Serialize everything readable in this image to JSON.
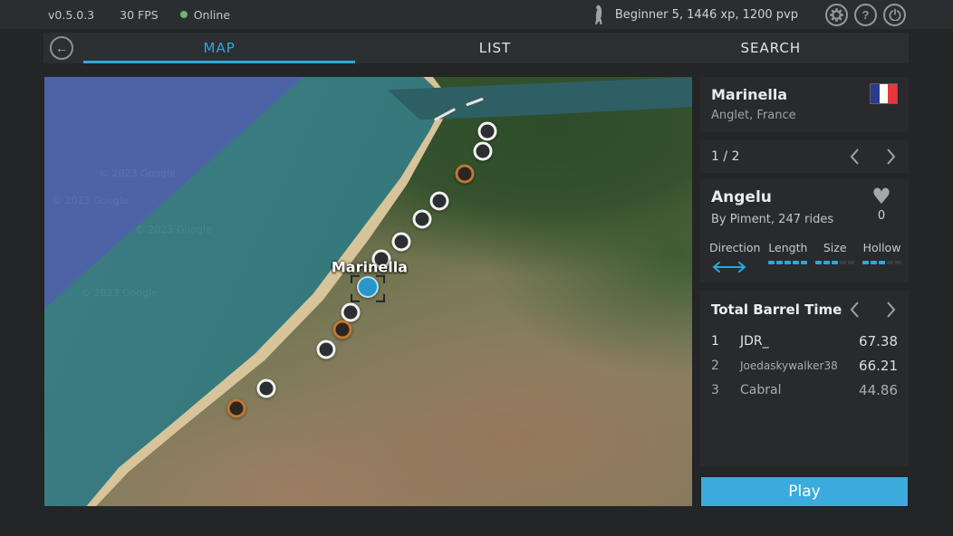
{
  "colors": {
    "accent": "#2ea7dd",
    "play_button": "#3aabdc",
    "marker_orange": "#bf7734",
    "marker_selected": "#2696cc",
    "online_green": "#6cb56f",
    "flag_blue": "#2a3b8f",
    "flag_red": "#e8363d"
  },
  "top_bar": {
    "version": "v0.5.0.3",
    "fps": "30 FPS",
    "online": "Online",
    "player_badge": "Beginner 5, 1446 xp, 1200 pvp",
    "icons": [
      "surfer-icon",
      "gear-icon",
      "question-icon",
      "power-icon"
    ]
  },
  "tabs": {
    "map": "MAP",
    "list": "LIST",
    "search": "SEARCH",
    "active": "MAP"
  },
  "location": {
    "name": "Marinella",
    "region": "Anglet, France",
    "flag": "france-flag"
  },
  "pagination": {
    "label": "1 / 2"
  },
  "spot": {
    "name": "Angelu",
    "byline": "By Piment, 247 rides",
    "likes": "0",
    "attrs": [
      {
        "label": "Direction",
        "type": "arrows"
      },
      {
        "label": "Length",
        "value": 5,
        "max": 5
      },
      {
        "label": "Size",
        "value": 3,
        "max": 5
      },
      {
        "label": "Hollow",
        "value": 3,
        "max": 5
      }
    ]
  },
  "leaderboard": {
    "title": "Total Barrel Time",
    "rows": [
      {
        "rank": "1",
        "name": "JDR_",
        "time": "67.38"
      },
      {
        "rank": "2",
        "name": "Joedaskywalker38",
        "time": "66.21"
      },
      {
        "rank": "3",
        "name": "Cabral",
        "time": "44.86"
      }
    ]
  },
  "play_label": "Play",
  "map": {
    "label": "Marinella",
    "watermark": "© 2023 Google",
    "markers": [
      {
        "x": 68.4,
        "y": 12.7,
        "type": "d"
      },
      {
        "x": 67.7,
        "y": 17.3,
        "type": "d"
      },
      {
        "x": 64.9,
        "y": 22.6,
        "type": "o"
      },
      {
        "x": 61.0,
        "y": 28.9,
        "type": "d"
      },
      {
        "x": 58.3,
        "y": 33.1,
        "type": "d"
      },
      {
        "x": 55.1,
        "y": 38.4,
        "type": "d"
      },
      {
        "x": 52.0,
        "y": 42.4,
        "type": "d"
      },
      {
        "x": 49.9,
        "y": 48.9,
        "type": "s"
      },
      {
        "x": 47.3,
        "y": 54.9,
        "type": "d"
      },
      {
        "x": 46.0,
        "y": 58.9,
        "type": "o"
      },
      {
        "x": 43.5,
        "y": 63.5,
        "type": "d"
      },
      {
        "x": 34.3,
        "y": 72.6,
        "type": "d"
      },
      {
        "x": 29.7,
        "y": 77.2,
        "type": "o"
      }
    ]
  }
}
